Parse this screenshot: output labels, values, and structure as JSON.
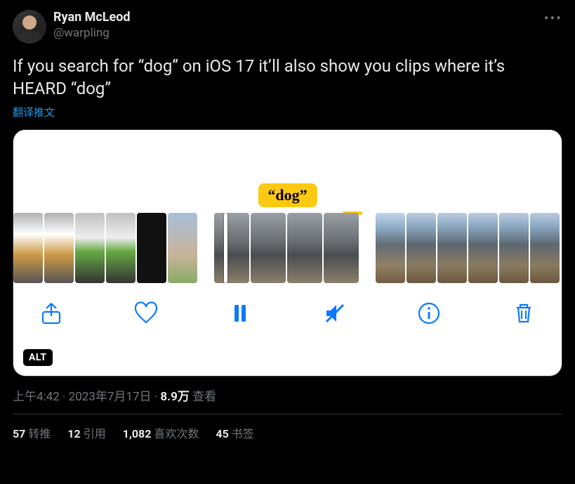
{
  "author": {
    "display_name": "Ryan McLeod",
    "handle": "@warpling"
  },
  "tweet_text": "If you search for “dog” on iOS 17 it’ll also show you clips where it’s HEARD “dog”",
  "translate_label": "翻译推文",
  "media": {
    "caption_tag": "“dog”",
    "alt_badge": "ALT",
    "toolbar_icons": [
      "share-icon",
      "heart-icon",
      "pause-icon",
      "mute-icon",
      "info-icon",
      "trash-icon"
    ]
  },
  "meta": {
    "time": "上午4:42",
    "sep1": " · ",
    "date": "2023年7月17日",
    "sep2": " · ",
    "views_num": "8.9万",
    "views_label": " 查看"
  },
  "stats": {
    "retweets_num": "57",
    "retweets_label": "转推",
    "quotes_num": "12",
    "quotes_label": "引用",
    "likes_num": "1,082",
    "likes_label": "喜欢次数",
    "bookmarks_num": "45",
    "bookmarks_label": "书签"
  }
}
